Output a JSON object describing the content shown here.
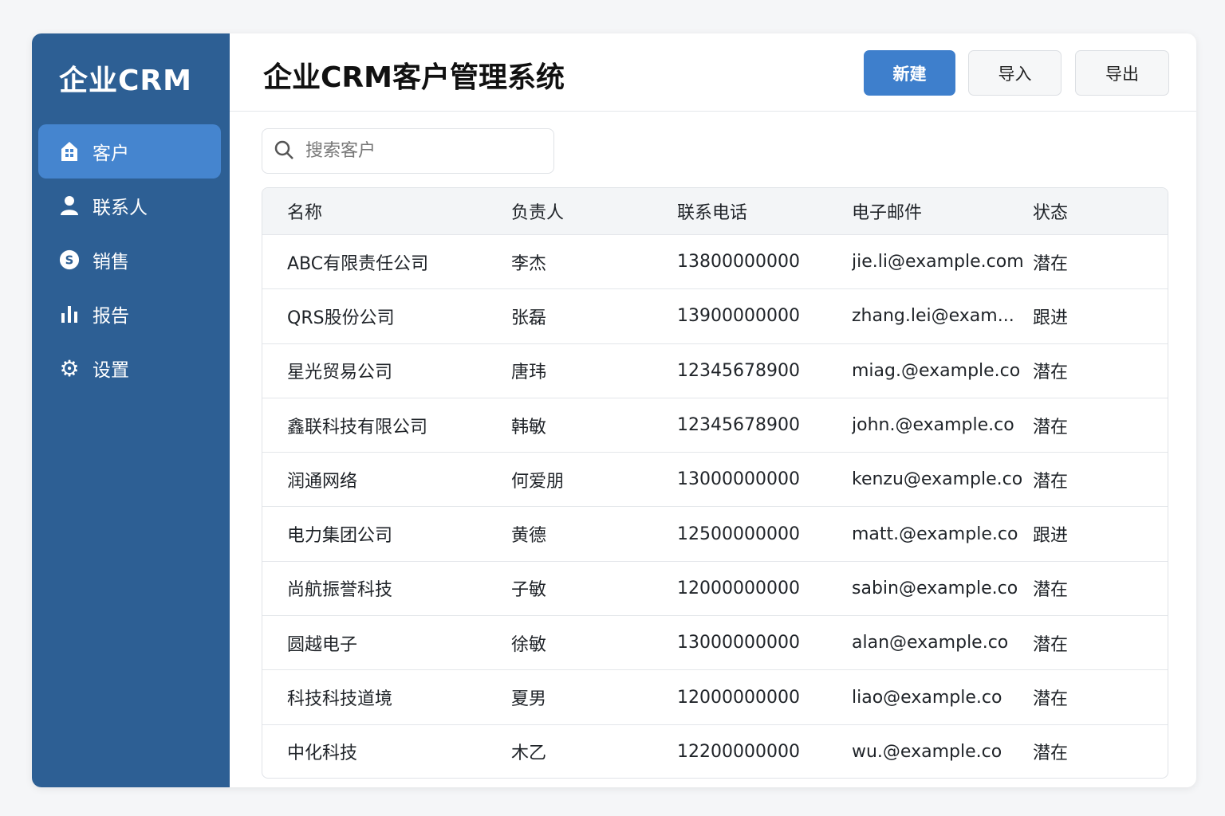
{
  "sidebar": {
    "logo": "企业CRM",
    "items": [
      {
        "label": "客户",
        "icon": "building-icon",
        "active": true
      },
      {
        "label": "联系人",
        "icon": "user-icon"
      },
      {
        "label": "销售",
        "icon": "dollar-circle-icon"
      },
      {
        "label": "报告",
        "icon": "bar-chart-icon"
      },
      {
        "label": "设置",
        "icon": "gear-icon"
      }
    ]
  },
  "header": {
    "title": "企业CRM客户管理系统",
    "buttons": [
      "新建",
      "导入",
      "导出"
    ]
  },
  "search": {
    "placeholder": "搜索客户"
  },
  "table": {
    "columns": [
      "名称",
      "负责人",
      "联系电话",
      "电子邮件",
      "状态"
    ],
    "rows": [
      [
        "ABC有限责任公司",
        "李杰",
        "13800000000",
        "jie.li@example.com",
        "潜在"
      ],
      [
        "QRS股份公司",
        "张磊",
        "13900000000",
        "zhang.lei@exam...",
        "跟进"
      ],
      [
        "星光贸易公司",
        "唐玮",
        "12345678900",
        "miag.@example.co",
        "潜在"
      ],
      [
        "鑫联科技有限公司",
        "韩敏",
        "12345678900",
        "john.@example.co",
        "潜在"
      ],
      [
        "润通网络",
        "何爱朋",
        "13000000000",
        "kenzu@example.co",
        "潜在"
      ],
      [
        "电力集团公司",
        "黄德",
        "12500000000",
        "matt.@example.co",
        "跟进"
      ],
      [
        "尚航振誉科技",
        "子敏",
        "12000000000",
        "sabin@example.co",
        "潜在"
      ],
      [
        "圆越电子",
        "徐敏",
        "13000000000",
        "alan@example.co",
        "潜在"
      ],
      [
        "科技科技道境",
        "夏男",
        "12000000000",
        "liao@example.co",
        "潜在"
      ],
      [
        "中化科技",
        "木乙",
        "12200000000",
        "wu.@example.co",
        "潜在"
      ]
    ]
  }
}
